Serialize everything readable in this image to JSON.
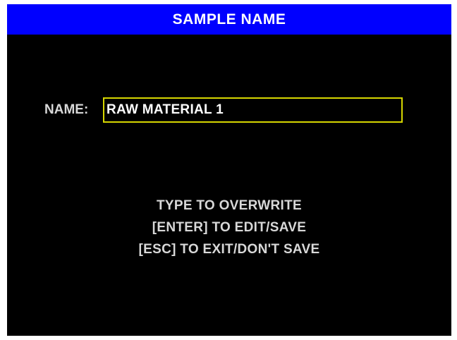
{
  "window": {
    "title": "SAMPLE NAME"
  },
  "form": {
    "name_label": "NAME:",
    "name_value": "RAW MATERIAL 1"
  },
  "instructions": [
    "TYPE TO OVERWRITE",
    "[ENTER] TO EDIT/SAVE",
    "[ESC] TO EXIT/DON'T SAVE"
  ],
  "colors": {
    "title_bar": "#0000ff",
    "background": "#000000",
    "text": "#d8d8d8",
    "input_border": "#d6d600"
  }
}
